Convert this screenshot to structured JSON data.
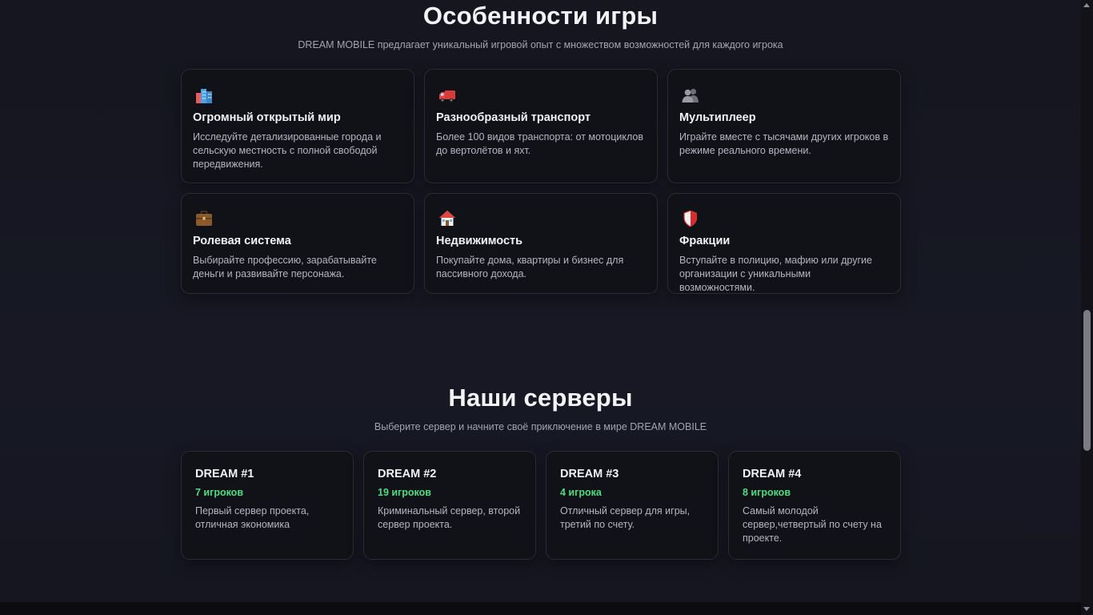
{
  "features_section": {
    "title": "Особенности игры",
    "subtitle": "DREAM MOBILE предлагает уникальный игровой опыт с множеством возможностей для каждого игрока",
    "items": [
      {
        "icon": "city-icon",
        "title": "Огромный открытый мир",
        "description": "Исследуйте детализированные города и сельскую местность с полной свободой передвижения."
      },
      {
        "icon": "truck-icon",
        "title": "Разнообразный транспорт",
        "description": "Более 100 видов транспорта: от мотоциклов до вертолётов и яхт."
      },
      {
        "icon": "people-icon",
        "title": "Мультиплеер",
        "description": "Играйте вместе с тысячами других игроков в режиме реального времени."
      },
      {
        "icon": "briefcase-icon",
        "title": "Ролевая система",
        "description": "Выбирайте профессию, зарабатывайте деньги и развивайте персонажа."
      },
      {
        "icon": "house-icon",
        "title": "Недвижимость",
        "description": "Покупайте дома, квартиры и бизнес для пассивного дохода."
      },
      {
        "icon": "shield-icon",
        "title": "Фракции",
        "description": "Вступайте в полицию, мафию или другие организации с уникальными возможностями."
      }
    ]
  },
  "servers_section": {
    "title": "Наши серверы",
    "subtitle": "Выберите сервер и начните своё приключение в мире DREAM MOBILE",
    "servers": [
      {
        "name": "DREAM #1",
        "players": "7 игроков",
        "description": "Первый сервер проекта, отличная экономика"
      },
      {
        "name": "DREAM #2",
        "players": "19 игроков",
        "description": "Криминальный сервер, второй сервер проекта."
      },
      {
        "name": "DREAM #3",
        "players": "4 игрока",
        "description": "Отличный сервер для игры, третий по счету."
      },
      {
        "name": "DREAM #4",
        "players": "8 игроков",
        "description": "Самый молодой сервер,четвертый по счету на проекте."
      }
    ]
  },
  "colors": {
    "background": "#15161f",
    "card": "#111218",
    "card_border": "#2a2b36",
    "players_accent": "#4ade80",
    "text_muted": "#b4b5c0"
  }
}
